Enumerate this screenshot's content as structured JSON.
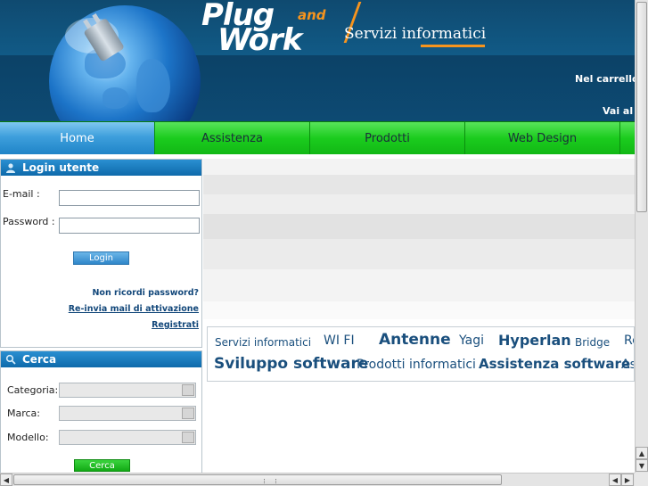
{
  "header": {
    "logo": {
      "word1": "Plug",
      "word2": "and",
      "word3": "Work",
      "tagline": "Servizi informatici"
    },
    "cart_text": "Nel carrello",
    "goto_text": "Vai al",
    "colors": {
      "brand_blue": "#115a86",
      "accent_orange": "#f7941d"
    }
  },
  "nav": {
    "items": [
      {
        "label": "Home",
        "active": true
      },
      {
        "label": "Assistenza",
        "active": false
      },
      {
        "label": "Prodotti",
        "active": false
      },
      {
        "label": "Web Design",
        "active": false
      },
      {
        "label": "",
        "active": false
      }
    ],
    "colors": {
      "green": "#1bcc1e",
      "active_blue": "#3e9fdc"
    }
  },
  "login": {
    "title": "Login utente",
    "icon": "user-icon",
    "email_label": "E-mail :",
    "email_value": "",
    "password_label": "Password :",
    "password_value": "",
    "login_button": "Login",
    "forgot_link": "Non ricordi password?",
    "resend_link": "Re-invia mail di attivazione",
    "register_link": "Registrati"
  },
  "search": {
    "title": "Cerca",
    "icon": "magnifier-icon",
    "category_label": "Categoria:",
    "category_value": "",
    "brand_label": "Marca:",
    "brand_value": "",
    "model_label": "Modello:",
    "model_value": "",
    "search_button": "Cerca"
  },
  "tagcloud": {
    "tags": [
      {
        "text": "Servizi informatici"
      },
      {
        "text": "WI FI"
      },
      {
        "text": "Antenne"
      },
      {
        "text": "Yagi"
      },
      {
        "text": "Hyperlan"
      },
      {
        "text": "Bridge"
      },
      {
        "text": "Re"
      },
      {
        "text": "Sviluppo software"
      },
      {
        "text": "Prodotti informatici"
      },
      {
        "text": "Assistenza software"
      },
      {
        "text": "As"
      }
    ]
  }
}
